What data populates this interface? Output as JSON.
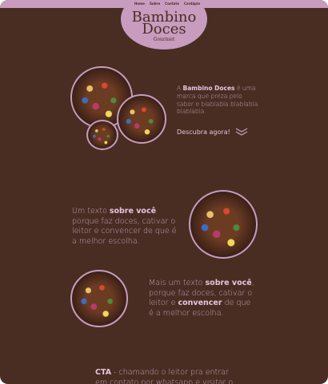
{
  "nav": {
    "items": [
      "Home",
      "Sobre",
      "Contato",
      "Cardápio"
    ]
  },
  "logo": {
    "line1": "Bambino",
    "line2": "Doces",
    "line3": "Gourmet"
  },
  "section1": {
    "prefix": "A ",
    "brand": "Bambino Doces",
    "rest": " é uma marca que preza pelo sabor e blablabla blablabla blablabla",
    "link": "Descubra agora!"
  },
  "section2": {
    "prefix": "Um texto ",
    "highlight": "sobre você",
    "rest": " porque faz doces, cativar o leitor e convencer de que é a melhor escolha."
  },
  "section3": {
    "prefix": "Mais um texto ",
    "highlight1": "sobre você",
    "mid": ", porque faz doces, cativar o leitor e ",
    "highlight2": "convencer",
    "rest": " de que é a melhor escolha."
  },
  "cta": {
    "highlight": "CTA",
    "rest": " - chamando o leitor pra entrar em contato por whatsapp e visitar o"
  },
  "colors": {
    "background": "#4a2d22",
    "accent": "#c79cbe",
    "text": "#c7a3bf"
  }
}
